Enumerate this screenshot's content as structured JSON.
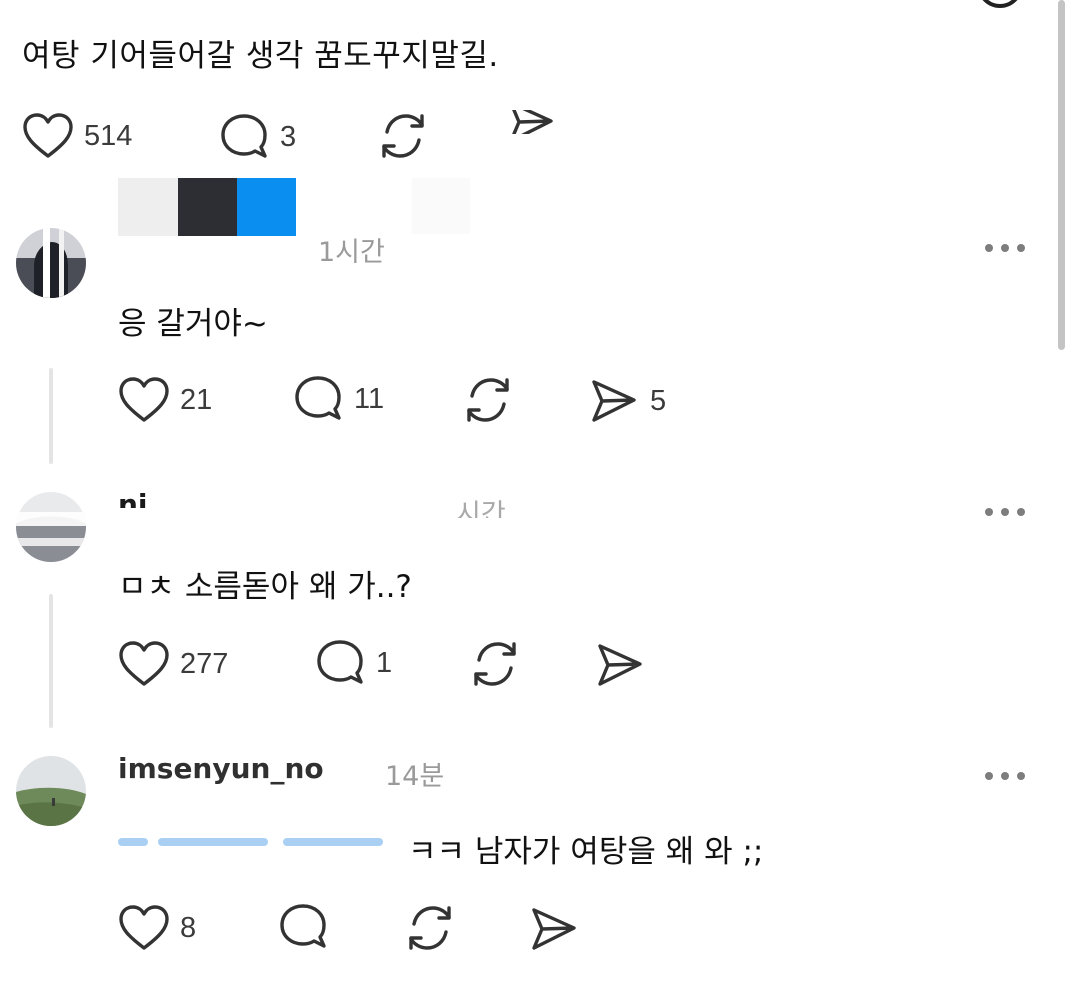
{
  "post": {
    "text": "여탕 기어들어갈 생각 꿈도꾸지말길.",
    "likes": "514",
    "comments": "3"
  },
  "colors": {
    "icon": "#333333",
    "count_text": "#3b3b3b",
    "time_text": "#9a9a9a",
    "mention": "#2a8be0",
    "swatch_light": "#eeeeee",
    "swatch_dark": "#2d2e33",
    "swatch_blue": "#0a8ef0"
  },
  "comments": [
    {
      "time": "1시간",
      "text": "응 갈거야~",
      "likes": "21",
      "replies": "11",
      "shares": "5"
    },
    {
      "username": "ni",
      "time": "시간",
      "text": "ㅁㅊ 소름돋아 왜 가..?",
      "likes": "277",
      "replies": "1"
    },
    {
      "username": "imsenyun_no",
      "time": "14분",
      "text": "ㅋㅋ 남자가 여탕을 왜 와 ;;",
      "likes": "8"
    }
  ],
  "icons": [
    "heart-icon",
    "comment-bubble-icon",
    "repost-icon",
    "send-icon",
    "more-dots-icon"
  ]
}
